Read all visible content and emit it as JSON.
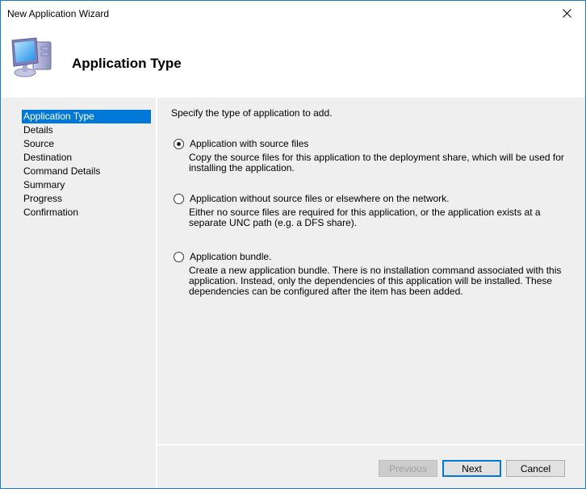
{
  "window": {
    "title": "New Application Wizard",
    "close_icon": "close-x-icon",
    "accent_color": "#0078d7"
  },
  "header": {
    "icon": "computer-icon",
    "title": "Application Type"
  },
  "nav": {
    "items": [
      {
        "label": "Application Type",
        "active": true
      },
      {
        "label": "Details",
        "active": false
      },
      {
        "label": "Source",
        "active": false
      },
      {
        "label": "Destination",
        "active": false
      },
      {
        "label": "Command Details",
        "active": false
      },
      {
        "label": "Summary",
        "active": false
      },
      {
        "label": "Progress",
        "active": false
      },
      {
        "label": "Confirmation",
        "active": false
      }
    ]
  },
  "content": {
    "instruction": "Specify the type of application to add.",
    "options": [
      {
        "label": "Application with source files",
        "description": "Copy the source files for this application to the deployment share, which will be used for installing the application.",
        "selected": true
      },
      {
        "label": "Application without source files or elsewhere on the network.",
        "description": "Either no source files are required for this application, or the application exists at a separate UNC path (e.g. a DFS share).",
        "selected": false
      },
      {
        "label": "Application bundle.",
        "description": "Create a new application bundle.  There is no installation command associated with this application.  Instead, only the dependencies of this application will be installed.  These dependencies can be configured after the item has been added.",
        "selected": false
      }
    ]
  },
  "buttons": {
    "previous": "Previous",
    "next": "Next",
    "cancel": "Cancel"
  }
}
